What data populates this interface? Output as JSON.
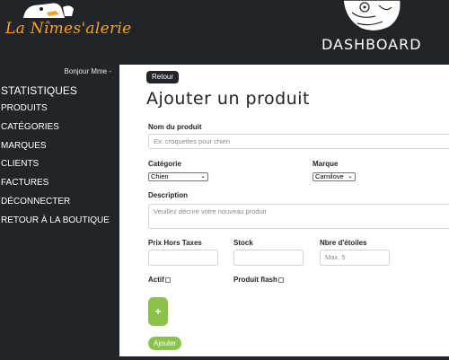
{
  "header": {
    "logo_text": "La Nîmes'alerie",
    "dashboard_title": "DASHBOARD"
  },
  "sidebar": {
    "greeting": "Bonjour Mme -",
    "items": [
      {
        "label": "STATISTIQUES"
      },
      {
        "label": "PRODUITS"
      },
      {
        "label": "CATÉGORIES"
      },
      {
        "label": "MARQUES"
      },
      {
        "label": "CLIENTS"
      },
      {
        "label": "FACTURES"
      },
      {
        "label": "DÉCONNECTER"
      },
      {
        "label": "RETOUR À LA BOUTIQUE"
      }
    ]
  },
  "form": {
    "back_label": "Retour",
    "title": "Ajouter un produit",
    "name_label": "Nom du produit",
    "name_placeholder": "Ex: croquettes pour chien",
    "category_label": "Catégorie",
    "category_value": "Chien",
    "brand_label": "Marque",
    "brand_value": "Carnilove",
    "description_label": "Description",
    "description_placeholder": "Veuillez décrire votre nouveau produit",
    "price_label": "Prix Hors Taxes",
    "stock_label": "Stock",
    "stars_label": "Nbre d'étoiles",
    "stars_placeholder": "Max. 5",
    "active_label": "Actif",
    "flash_label": "Produit flash",
    "plus_label": "+",
    "submit_label": "Ajouter"
  },
  "colors": {
    "background": "#212529",
    "accent_green": "#8bc34a",
    "logo_orange": "#f4a227"
  }
}
